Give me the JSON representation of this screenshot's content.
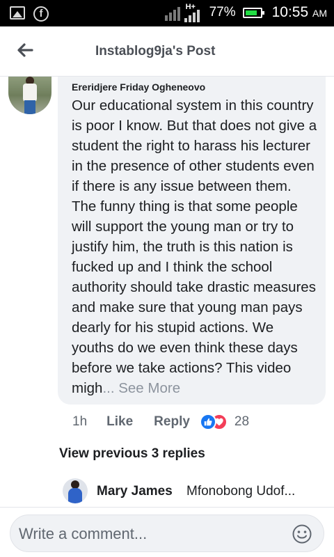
{
  "status_bar": {
    "battery_pct": "77%",
    "time": "10:55",
    "ampm": "AM",
    "network_label": "H+",
    "icons": [
      "gallery-icon",
      "facebook-icon",
      "signal-icon",
      "hplus-signal-icon",
      "battery-icon"
    ]
  },
  "header": {
    "title": "Instablog9ja's Post",
    "back_icon": "back-arrow-icon"
  },
  "comment": {
    "author": "Ereridjere Friday Ogheneovo",
    "text": "Our educational system in this country is poor I know. But that does not give a student the right to harass his lecturer in the presence of other students even if there is any issue between them. The funny thing is that some people will support the young man or try to justify him, the truth is this nation is fucked up and I think the school authority should take drastic measures and make sure that young man pays dearly for his stupid actions. We youths do we even think these days before we take actions? This video migh",
    "ellipsis": "...",
    "see_more": "See More",
    "time": "1h",
    "like_label": "Like",
    "reply_label": "Reply",
    "reaction_count": "28",
    "reactions": [
      "like",
      "love"
    ],
    "colors": {
      "like": "#1877f2",
      "love": "#f33e58"
    }
  },
  "replies": {
    "view_previous": "View previous 3 replies",
    "latest": {
      "name": "Mary James",
      "text": "Mfonobong Udof..."
    }
  },
  "composer": {
    "placeholder": "Write a comment...",
    "emoji_icon": "emoji-icon"
  }
}
